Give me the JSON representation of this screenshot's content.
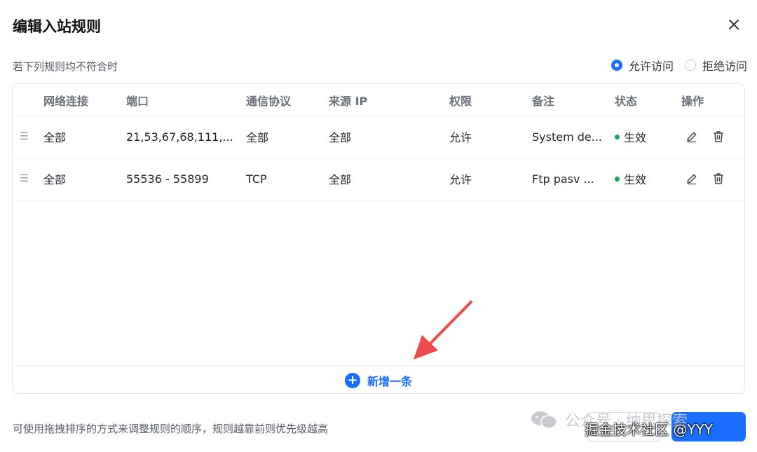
{
  "dialog": {
    "title": "编辑入站规则",
    "subtitle": "若下列规则均不符合时",
    "radio_allow": "允许访问",
    "radio_deny": "拒绝访问",
    "selected": "allow"
  },
  "table": {
    "headers": [
      "网络连接",
      "端口",
      "通信协议",
      "来源 IP",
      "权限",
      "备注",
      "状态",
      "操作"
    ],
    "rows": [
      {
        "network": "全部",
        "port": "21,53,67,68,111,...",
        "protocol": "全部",
        "source": "全部",
        "permission": "允许",
        "note": "System de...",
        "status": "生效"
      },
      {
        "network": "全部",
        "port": "55536 - 55899",
        "protocol": "TCP",
        "source": "全部",
        "permission": "允许",
        "note": "Ftp pasv ...",
        "status": "生效"
      }
    ],
    "add_label": "新增一条"
  },
  "footer": {
    "hint": "可使用拖拽排序的方式来调整规则的顺序，规则越靠前则优先级越高"
  },
  "watermark": {
    "line1": "公众号 · 纳思探索",
    "line2": "掘金技术社区 @YYY"
  },
  "colors": {
    "accent": "#1a6dff",
    "status_active": "#18a058",
    "annotation_arrow": "#ee4b4b"
  }
}
